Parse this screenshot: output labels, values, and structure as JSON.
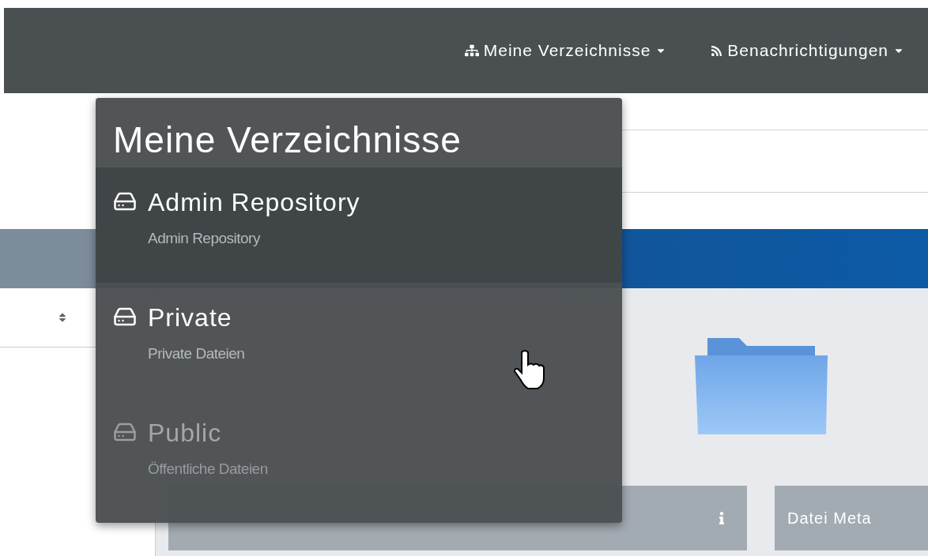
{
  "navbar": {
    "items": [
      {
        "kind": "folders",
        "label": "Meine Verzeichnisse"
      },
      {
        "kind": "feed",
        "label": "Benachrichtigungen"
      }
    ]
  },
  "dropdown": {
    "title": "Meine Verzeichnisse",
    "items": [
      {
        "title": "Admin Repository",
        "subtitle": "Admin Repository",
        "selected": true,
        "disabled": false
      },
      {
        "title": "Private",
        "subtitle": "Private Dateien",
        "selected": false,
        "disabled": false
      },
      {
        "title": "Public",
        "subtitle": "Öffentliche Dateien",
        "selected": false,
        "disabled": true
      }
    ]
  },
  "panels": [
    {
      "kind": "info"
    },
    {
      "kind": "titled",
      "title": "Datei Meta"
    }
  ]
}
